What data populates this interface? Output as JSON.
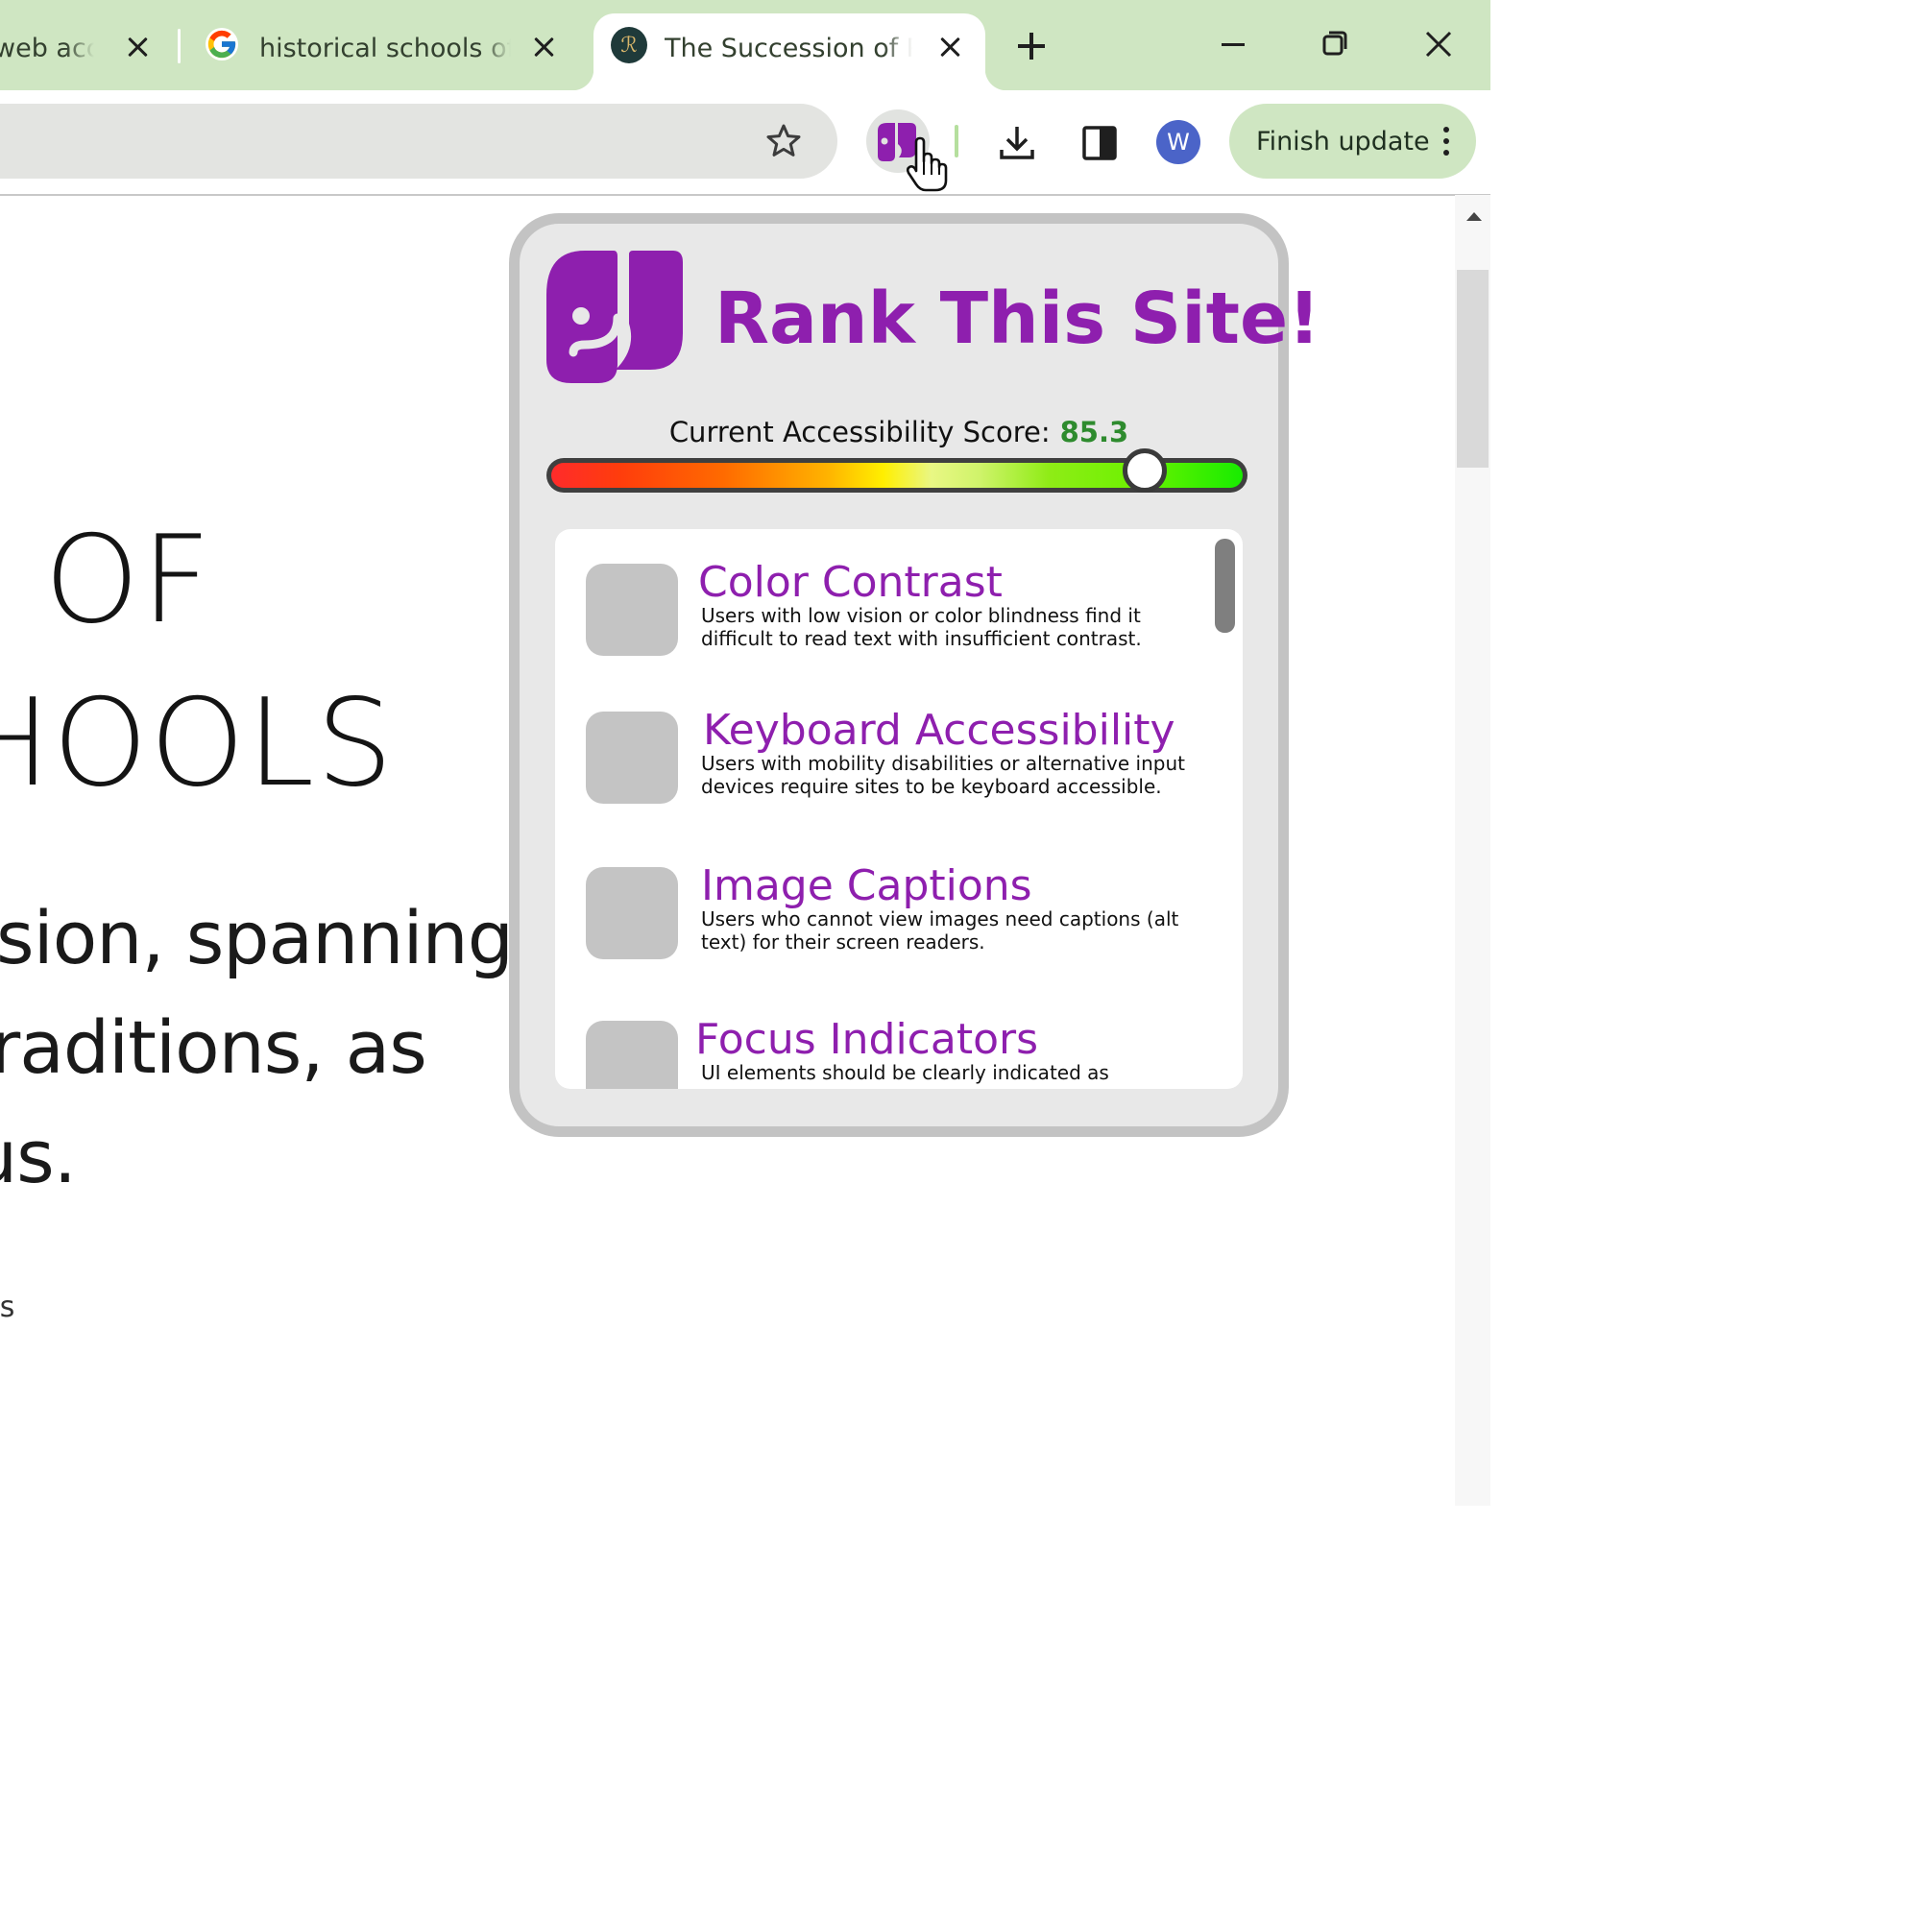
{
  "tabs": [
    {
      "title": "web acce",
      "favicon": "none"
    },
    {
      "title": "historical schools of p",
      "favicon": "google-icon"
    },
    {
      "title": "The Succession of Ph",
      "favicon": "site-favicon",
      "active": true
    }
  ],
  "tab_new_label": "+",
  "favicon_letters": {
    "google": "G",
    "site": "ℛ"
  },
  "toolbar": {
    "finish_update": "Finish update",
    "avatar_letter": "W"
  },
  "page": {
    "heading_line1": "OF",
    "heading_line2": "HOOLS",
    "para_line1": "sion, spanning",
    "para_line2": "raditions, as",
    "para_line3": "us.",
    "small_text": "ts"
  },
  "popup": {
    "title": "Rank This Site!",
    "score_label": "Current Accessibility Score:",
    "score_value": "85.3",
    "score_percent": 85.3,
    "items": [
      {
        "title": "Color Contrast",
        "desc": "Users with low vision or color blindness find it difficult to read text with insufficient contrast."
      },
      {
        "title": "Keyboard Accessibility",
        "desc": "Users with mobility disabilities or alternative input devices require sites to be keyboard accessible."
      },
      {
        "title": "Image Captions",
        "desc": "Users who cannot view images need captions (alt text) for their screen readers."
      },
      {
        "title": "Focus Indicators",
        "desc": "UI elements should be clearly indicated as"
      }
    ]
  },
  "colors": {
    "tabstrip": "#cfe6c2",
    "accent_purple": "#8e1fae",
    "score_green": "#2e8b2e"
  }
}
